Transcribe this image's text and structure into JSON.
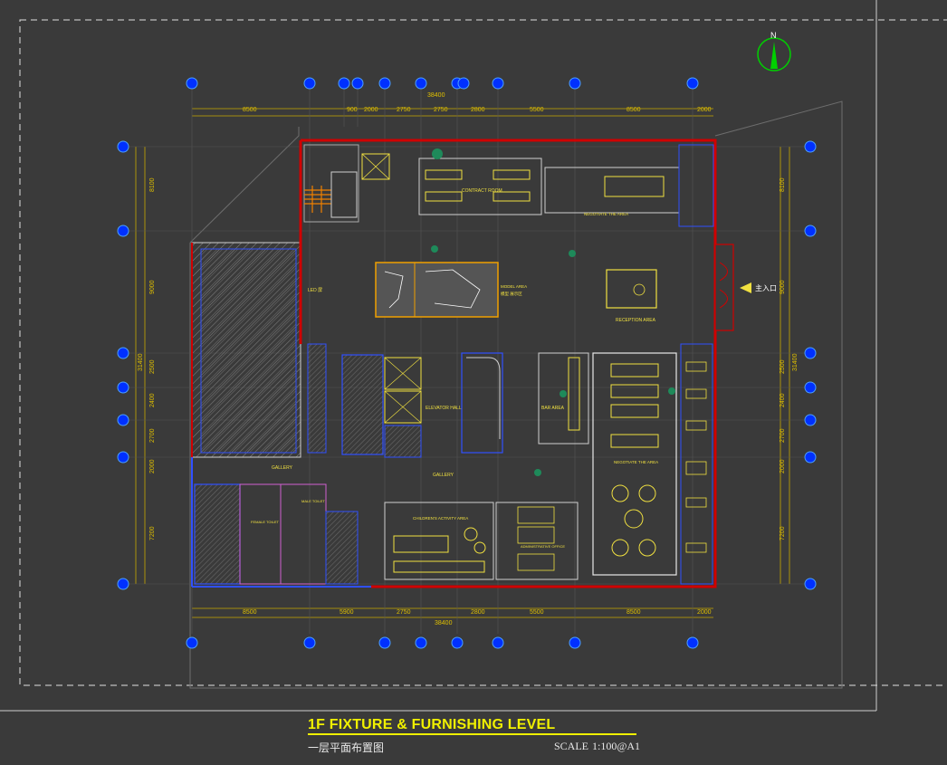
{
  "title_block": {
    "title": "1F FIXTURE & FURNISHING LEVEL",
    "subtitle": "一层平面布置图",
    "scale_label": "SCALE",
    "scale_value": "1:100@A1"
  },
  "dimensions": {
    "top_total": "38400",
    "bottom_total": "38400",
    "top_segments": [
      "8500",
      "900",
      "2000",
      "2750",
      "2750",
      "2800",
      "5500",
      "8500",
      "2000"
    ],
    "bottom_segments": [
      "8500",
      "5900",
      "2750",
      "2800",
      "5500",
      "8500",
      "2000"
    ],
    "left_segments": [
      "8100",
      "9000",
      "2500",
      "2400",
      "2700",
      "2000",
      "7200"
    ],
    "left_total": "31400",
    "right_segments": [
      "8100",
      "9000",
      "2500",
      "2400",
      "2700",
      "2000",
      "7200"
    ],
    "right_total": "31400"
  },
  "rooms": {
    "contract_room": "CONTRACT ROOM",
    "model_area": "MODEL AREA",
    "model_area_cn": "模型 展示区",
    "reception_area": "RECEPTION AREA",
    "elevator_hall": "ELEVATOR HALL",
    "bar_area": "BAR AREA",
    "gallery_left": "GALLERY",
    "gallery_center": "GALLERY",
    "negotiate_area": "NEGOTIATE THE AREA",
    "childrens_area": "CHILDREN'S ACTIVITY AREA",
    "admin_office": "ADMINISTRATIVE OFFICE",
    "female_toilet": "FEMALE TOILET",
    "male_toilet": "MALE TOILET",
    "led": "LED 屏",
    "main_entrance": "主入口"
  },
  "north_arrow": {
    "label": "N"
  },
  "colors": {
    "background": "#3a3a3a",
    "wall": "#d00000",
    "furniture": "#f0e040",
    "grid": "#2060ff",
    "dimension": "#e0c000"
  }
}
